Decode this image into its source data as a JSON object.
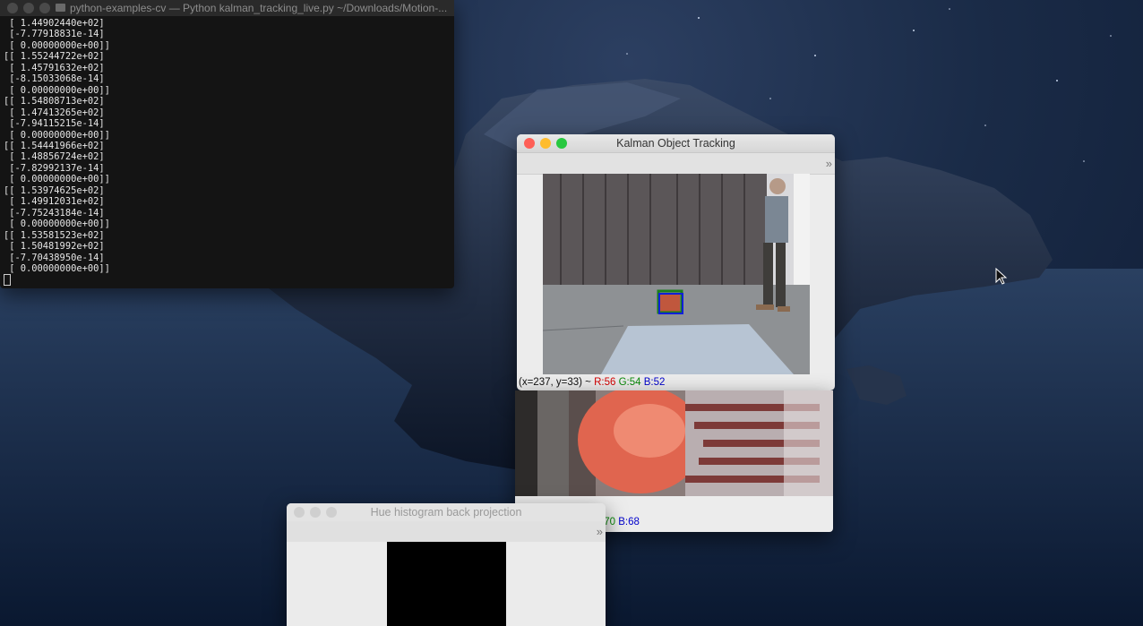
{
  "terminal": {
    "title": "python-examples-cv — Python kalman_tracking_live.py ~/Downloads/Motion-...",
    "lines": [
      " [ 1.44902440e+02]",
      " [-7.77918831e-14]",
      " [ 0.00000000e+00]]",
      "[[ 1.55244722e+02]",
      " [ 1.45791632e+02]",
      " [-8.15033068e-14]",
      " [ 0.00000000e+00]]",
      "[[ 1.54808713e+02]",
      " [ 1.47413265e+02]",
      " [-7.94115215e-14]",
      " [ 0.00000000e+00]]",
      "[[ 1.54441966e+02]",
      " [ 1.48856724e+02]",
      " [-7.82992137e-14]",
      " [ 0.00000000e+00]]",
      "[[ 1.53974625e+02]",
      " [ 1.49912031e+02]",
      " [-7.75243184e-14]",
      " [ 0.00000000e+00]]",
      "[[ 1.53581523e+02]",
      " [ 1.50481992e+02]",
      " [-7.70438950e-14]",
      " [ 0.00000000e+00]]"
    ]
  },
  "kalman": {
    "title": "Kalman Object Tracking",
    "toolbar_chevron": "»",
    "status_coords": "(x=237, y=33) ~ ",
    "status_r": "R:56",
    "status_g": "G:54",
    "status_b": "B:52"
  },
  "zoom": {
    "status_g": ":70",
    "status_b": "B:68"
  },
  "hue": {
    "title": "Hue histogram back projection",
    "toolbar_chevron": "»"
  },
  "colors": {
    "close": "#fe5f57",
    "minimize": "#febc2e",
    "zoom": "#28c840",
    "r_text": "#d40000",
    "g_text": "#0a8a0a",
    "b_text": "#0000cc"
  },
  "icons": [
    "close-icon",
    "minimize-icon",
    "zoom-icon",
    "chevron-right-icon",
    "cursor-arrow-icon"
  ]
}
